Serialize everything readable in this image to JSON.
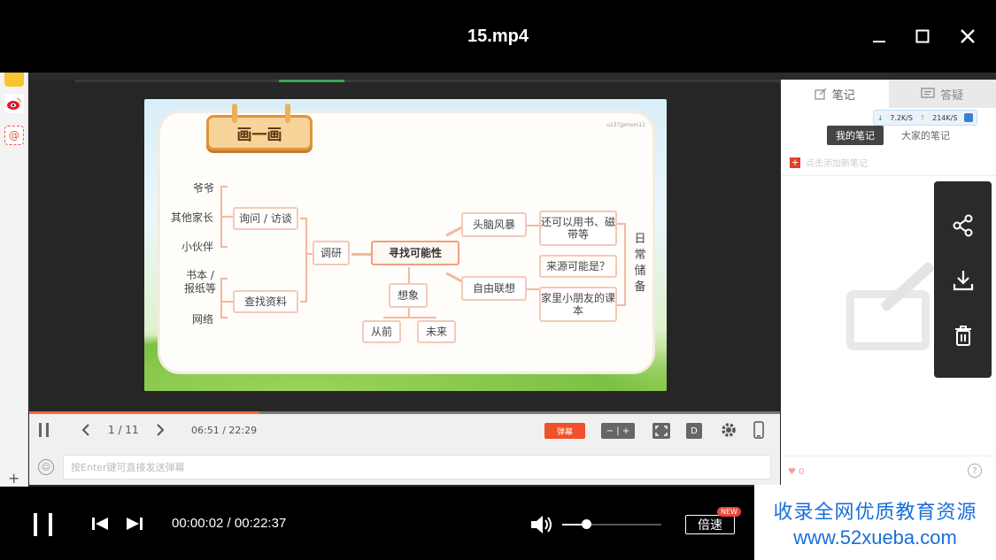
{
  "window": {
    "title": "15.mp4"
  },
  "slide": {
    "banner": "画一画",
    "watermark": "u137jpmom11",
    "left_items": [
      "爷爷",
      "其他家长",
      "小伙伴",
      "书本 / 报纸等",
      "网络"
    ],
    "branch1": "询问 / 访谈",
    "branch2": "查找资料",
    "research": "调研",
    "core": "寻找可能性",
    "imagine": "想象",
    "past": "从前",
    "future": "未来",
    "brainstorm": "头脑风暴",
    "free_assoc": "自由联想",
    "r1": "还可以用书、磁带等",
    "r2": "来源可能是？",
    "r3": "家里小朋友的课本",
    "side": "日常储备"
  },
  "inner_controls": {
    "page": "1 / 11",
    "time": "06:51 / 22:29",
    "danmu": "弹幕",
    "zoom": "− | +",
    "d_label": "D",
    "input_placeholder": "按Enter键可直接发送弹幕"
  },
  "notes_panel": {
    "tab_notes": "笔记",
    "tab_qa": "答疑",
    "speed_down": "7.2K/S",
    "speed_up": "214K/S",
    "my_notes": "我的笔记",
    "all_notes": "大家的笔记",
    "add_note": "点击添加新笔记",
    "likes": "0",
    "help": "?"
  },
  "player": {
    "time": "00:00:02 / 00:22:37",
    "speed_label": "倍速",
    "new_badge": "NEW",
    "volume_level": 0.24
  },
  "ad": {
    "line1": "收录全网优质教育资源",
    "line2": "www.52xueba.com"
  },
  "colors": {
    "accent": "#f26b3a",
    "danmu": "#f0502a",
    "ad_text": "#1a6fd8"
  }
}
